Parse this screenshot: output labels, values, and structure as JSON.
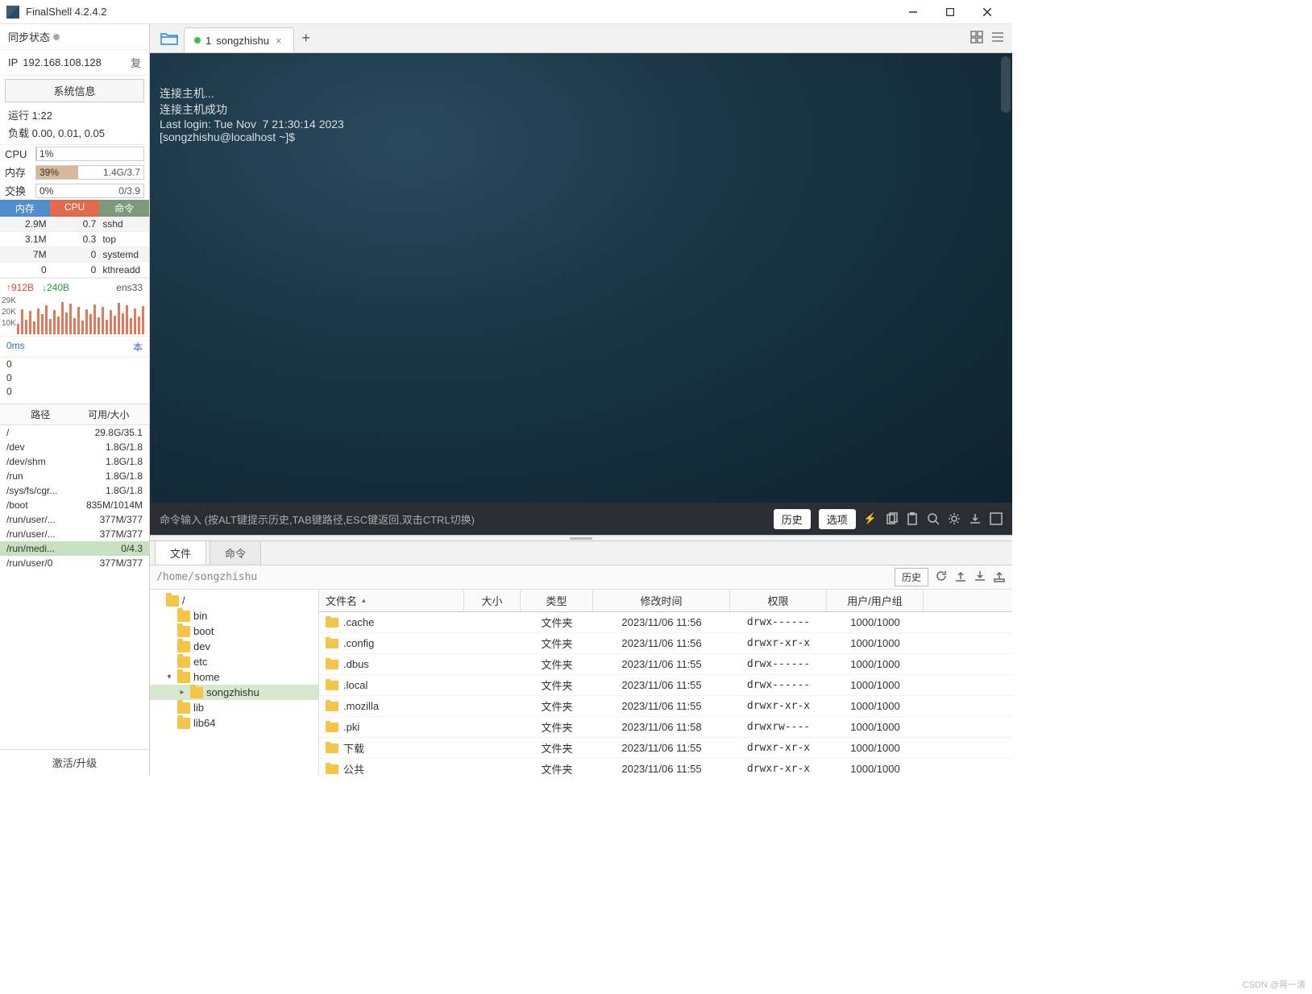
{
  "window": {
    "title": "FinalShell 4.2.4.2"
  },
  "sidebar": {
    "sync_label": "同步状态",
    "ip_label": "IP",
    "ip_value": "192.168.108.128",
    "copy_label": "复",
    "sysinfo_btn": "系统信息",
    "uptime_label": "运行",
    "uptime_value": "1:22",
    "load_label": "负载",
    "load_value": "0.00, 0.01, 0.05",
    "cpu": {
      "label": "CPU",
      "pct": "1%",
      "fill": 1
    },
    "mem": {
      "label": "内存",
      "pct": "39%",
      "right": "1.4G/3.7",
      "fill": 39
    },
    "swap": {
      "label": "交换",
      "pct": "0%",
      "right": "0/3.9",
      "fill": 0
    },
    "proc_hdr": {
      "mem": "内存",
      "cpu": "CPU",
      "cmd": "命令"
    },
    "procs": [
      {
        "mem": "2.9M",
        "cpu": "0.7",
        "cmd": "sshd"
      },
      {
        "mem": "3.1M",
        "cpu": "0.3",
        "cmd": "top"
      },
      {
        "mem": "7M",
        "cpu": "0",
        "cmd": "systemd"
      },
      {
        "mem": "0",
        "cpu": "0",
        "cmd": "kthreadd"
      }
    ],
    "net": {
      "up": "↑912B",
      "down": "↓240B",
      "iface": "ens33"
    },
    "spark_y": [
      "29K",
      "20K",
      "10K"
    ],
    "latency": {
      "ms": "0ms",
      "local": "本"
    },
    "zeros": [
      "0",
      "0",
      "0"
    ],
    "disk_hdr": {
      "path": "路径",
      "size": "可用/大小"
    },
    "disks": [
      {
        "path": "/",
        "size": "29.8G/35.1"
      },
      {
        "path": "/dev",
        "size": "1.8G/1.8"
      },
      {
        "path": "/dev/shm",
        "size": "1.8G/1.8"
      },
      {
        "path": "/run",
        "size": "1.8G/1.8"
      },
      {
        "path": "/sys/fs/cgr...",
        "size": "1.8G/1.8"
      },
      {
        "path": "/boot",
        "size": "835M/1014M"
      },
      {
        "path": "/run/user/...",
        "size": "377M/377"
      },
      {
        "path": "/run/user/...",
        "size": "377M/377"
      },
      {
        "path": "/run/medi...",
        "size": "0/4.3",
        "sel": true
      },
      {
        "path": "/run/user/0",
        "size": "377M/377"
      }
    ],
    "activate": "激活/升级"
  },
  "tabs": {
    "active_num": "1",
    "active_name": "songzhishu"
  },
  "terminal": {
    "lines": [
      "连接主机...",
      "连接主机成功",
      "Last login: Tue Nov  7 21:30:14 2023",
      "[songzhishu@localhost ~]$"
    ]
  },
  "cmdbar": {
    "label": "命令输入",
    "hint": "(按ALT键提示历史,TAB键路径,ESC键返回,双击CTRL切换)",
    "history": "历史",
    "options": "选项"
  },
  "bottom": {
    "tab_file": "文件",
    "tab_cmd": "命令",
    "path": "/home/songzhishu",
    "history_btn": "历史",
    "tree": [
      {
        "d": 0,
        "name": "/",
        "exp": ""
      },
      {
        "d": 1,
        "name": "bin"
      },
      {
        "d": 1,
        "name": "boot"
      },
      {
        "d": 1,
        "name": "dev"
      },
      {
        "d": 1,
        "name": "etc"
      },
      {
        "d": 1,
        "name": "home",
        "exp": "▾"
      },
      {
        "d": 2,
        "name": "songzhishu",
        "exp": "▸",
        "sel": true
      },
      {
        "d": 1,
        "name": "lib"
      },
      {
        "d": 1,
        "name": "lib64"
      }
    ],
    "cols": {
      "name": "文件名",
      "size": "大小",
      "type": "类型",
      "date": "修改时间",
      "perm": "权限",
      "own": "用户/用户组"
    },
    "files": [
      {
        "name": ".cache",
        "type": "文件夹",
        "date": "2023/11/06 11:56",
        "perm": "drwx------",
        "own": "1000/1000"
      },
      {
        "name": ".config",
        "type": "文件夹",
        "date": "2023/11/06 11:56",
        "perm": "drwxr-xr-x",
        "own": "1000/1000"
      },
      {
        "name": ".dbus",
        "type": "文件夹",
        "date": "2023/11/06 11:55",
        "perm": "drwx------",
        "own": "1000/1000"
      },
      {
        "name": ".local",
        "type": "文件夹",
        "date": "2023/11/06 11:55",
        "perm": "drwx------",
        "own": "1000/1000"
      },
      {
        "name": ".mozilla",
        "type": "文件夹",
        "date": "2023/11/06 11:55",
        "perm": "drwxr-xr-x",
        "own": "1000/1000"
      },
      {
        "name": ".pki",
        "type": "文件夹",
        "date": "2023/11/06 11:58",
        "perm": "drwxrw----",
        "own": "1000/1000"
      },
      {
        "name": "下载",
        "type": "文件夹",
        "date": "2023/11/06 11:55",
        "perm": "drwxr-xr-x",
        "own": "1000/1000"
      },
      {
        "name": "公共",
        "type": "文件夹",
        "date": "2023/11/06 11:55",
        "perm": "drwxr-xr-x",
        "own": "1000/1000"
      }
    ]
  },
  "watermark": "CSDN @蒋一清"
}
